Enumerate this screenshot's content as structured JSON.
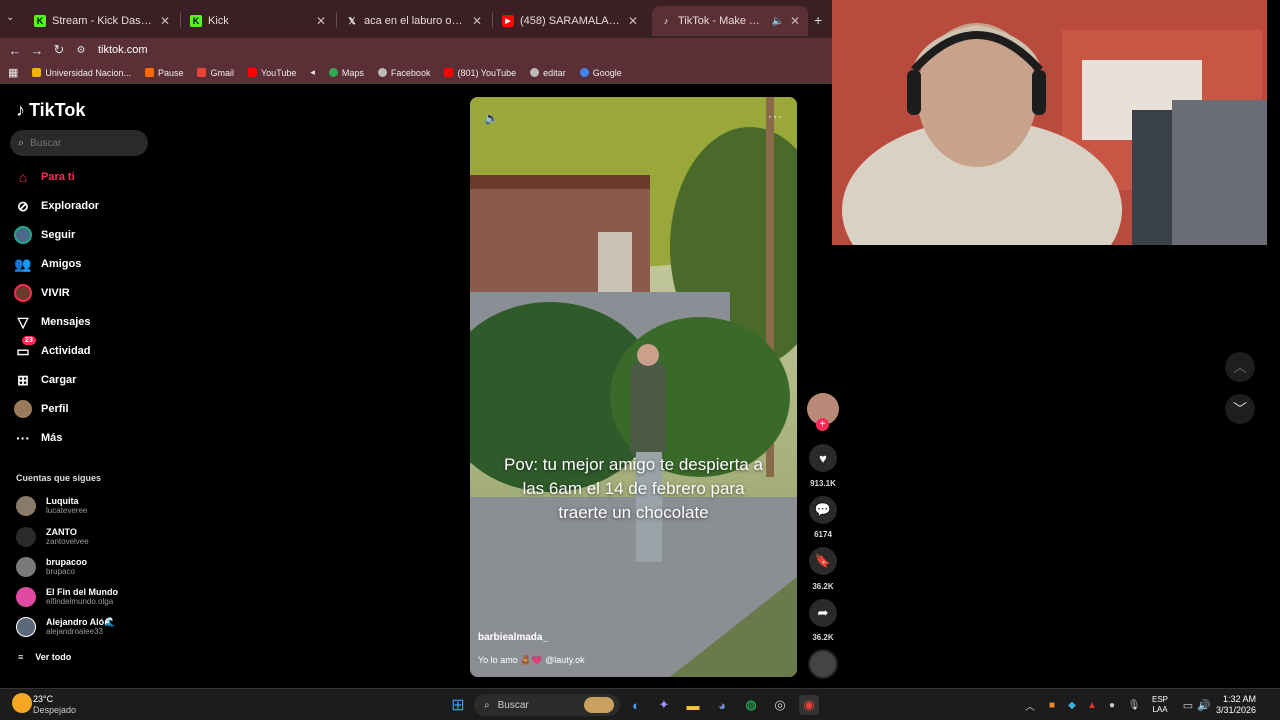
{
  "browser": {
    "tabs": [
      {
        "title": "Stream - Kick Dashboard",
        "favicon": "kick-icon"
      },
      {
        "title": "Kick",
        "favicon": "kick-icon"
      },
      {
        "title": "aca en el laburo on X: \"caso ais",
        "favicon": "x-icon"
      },
      {
        "title": "(458) SARAMALACARA, Zell - a",
        "favicon": "youtube-icon"
      },
      {
        "title": "TikTok - Make Your Day",
        "favicon": "tiktok-icon"
      }
    ],
    "url": "tiktok.com",
    "bookmarks": [
      {
        "label": "Universidad Nacion...",
        "color": "#f0b400"
      },
      {
        "label": "Pause",
        "color": "#ff6a00"
      },
      {
        "label": "Gmail",
        "color": "#ea4335"
      },
      {
        "label": "YouTube",
        "color": "#ff0000"
      },
      {
        "label": "Maps",
        "color": "#34a853"
      },
      {
        "label": "Facebook",
        "color": "#bbbbbb"
      },
      {
        "label": "(801) YouTube",
        "color": "#ff0000"
      },
      {
        "label": "editar",
        "color": "#bbbbbb"
      },
      {
        "label": "Google",
        "color": "#4285f4"
      }
    ]
  },
  "tiktok": {
    "logo": "TikTok",
    "search_placeholder": "Buscar",
    "nav": [
      {
        "label": "Para ti",
        "icon": "home-icon"
      },
      {
        "label": "Explorador",
        "icon": "compass-icon"
      },
      {
        "label": "Seguir",
        "icon": "following-icon"
      },
      {
        "label": "Amigos",
        "icon": "friends-icon"
      },
      {
        "label": "VIVIR",
        "icon": "live-icon"
      },
      {
        "label": "Mensajes",
        "icon": "send-icon"
      },
      {
        "label": "Actividad",
        "icon": "activity-icon",
        "badge": "23"
      },
      {
        "label": "Cargar",
        "icon": "upload-icon"
      },
      {
        "label": "Perfil",
        "icon": "profile-icon"
      },
      {
        "label": "Más",
        "icon": "more-icon"
      }
    ],
    "following_title": "Cuentas que sigues",
    "following": [
      {
        "name": "Luquita",
        "handle": "lucateveree"
      },
      {
        "name": "ZANTO",
        "handle": "zantovelvee"
      },
      {
        "name": "brupacoo",
        "handle": "brupaco"
      },
      {
        "name": "El Fin del Mundo",
        "handle": "elfindelmundo.olga"
      },
      {
        "name": "Alejandro Aló🌊",
        "handle": "alejandroalee33"
      }
    ],
    "see_all": "Ver todo",
    "video": {
      "caption": "Pov: tu mejor amigo te despierta a las 6am el 14 de febrero para traerte un chocolate",
      "author": "barbiealmada_",
      "description": "Yo lo amo 🧸💗 @lauty.ok",
      "likes": "913.1K",
      "comments": "6174",
      "saves": "36.2K",
      "shares": "36.2K"
    }
  },
  "taskbar": {
    "weather_temp": "23°C",
    "weather_desc": "Despejado",
    "search": "Buscar",
    "lang": "ESP",
    "lang2": "LAA",
    "time": "1:32 AM",
    "date": "3/31/2026"
  }
}
